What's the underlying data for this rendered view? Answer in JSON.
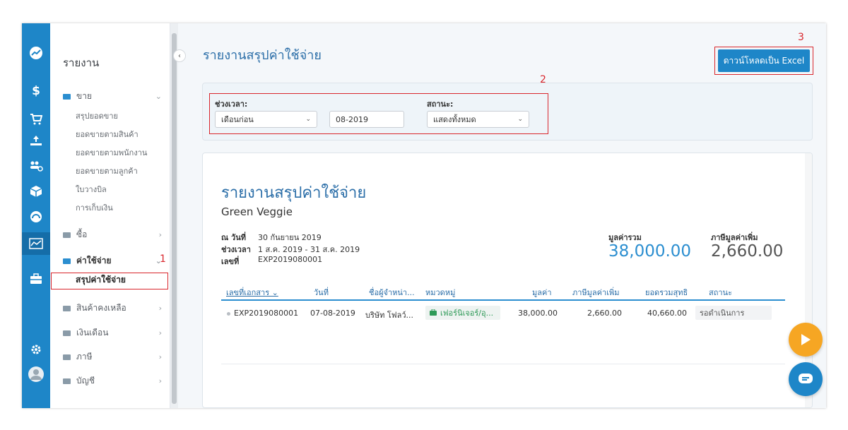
{
  "sidebar": {
    "title": "รายงาน",
    "groups": {
      "sales": {
        "label": "ขาย",
        "items": [
          "สรุปยอดขาย",
          "ยอดขายตามสินค้า",
          "ยอดขายตามพนักงาน",
          "ยอดขายตามลูกค้า",
          "ใบวางบิล",
          "การเก็บเงิน"
        ]
      },
      "purchase": {
        "label": "ซื้อ"
      },
      "expense": {
        "label": "ค่าใช้จ่าย",
        "active_item": "สรุปค่าใช้จ่าย"
      },
      "inventory": {
        "label": "สินค้าคงเหลือ"
      },
      "salary": {
        "label": "เงินเดือน"
      },
      "tax": {
        "label": "ภาษี"
      },
      "account": {
        "label": "บัญชี"
      }
    }
  },
  "header": {
    "title": "รายงานสรุปค่าใช้จ่าย",
    "excel_button": "ดาวน์โหลดเป็น Excel"
  },
  "annotations": {
    "n1": "1",
    "n2": "2",
    "n3": "3"
  },
  "filters": {
    "period_label": "ช่วงเวลา:",
    "period_value": "เดือนก่อน",
    "month_value": "08-2019",
    "status_label": "สถานะ:",
    "status_value": "แสดงทั้งหมด"
  },
  "report": {
    "title": "รายงานสรุปค่าใช้จ่าย",
    "company": "Green Veggie",
    "as_of_label": "ณ วันที่",
    "as_of_value": "30 กันยายน 2019",
    "period_label": "ช่วงเวลา",
    "period_value": "1 ส.ค. 2019 - 31 ส.ค. 2019",
    "number_label": "เลขที่",
    "number_value": "EXP2019080001",
    "total_label": "มูลค่ารวม",
    "total_value": "38,000.00",
    "vat_label": "ภาษีมูลค่าเพิ่ม",
    "vat_value": "2,660.00"
  },
  "table": {
    "headers": {
      "doc_no": "เลขที่เอกสาร ⌄",
      "date": "วันที่",
      "vendor": "ชื่อผู้จำหน่า...",
      "category": "หมวดหมู่",
      "value": "มูลค่า",
      "vat": "ภาษีมูลค่าเพิ่ม",
      "net": "ยอดรวมสุทธิ",
      "status": "สถานะ"
    },
    "rows": [
      {
        "doc_no": "EXP2019080001",
        "date": "07-08-2019",
        "vendor": "บริษัท โฟลว์...",
        "category": "เฟอร์นิเจอร์/อุ...",
        "value": "38,000.00",
        "vat": "2,660.00",
        "net": "40,660.00",
        "status": "รอดำเนินการ"
      }
    ]
  },
  "colors": {
    "brand": "#1e86c8",
    "accent_text": "#2b6ea8",
    "annotation": "#d9262c",
    "fab_play": "#f6a623",
    "fab_chat": "#1e86c8"
  }
}
